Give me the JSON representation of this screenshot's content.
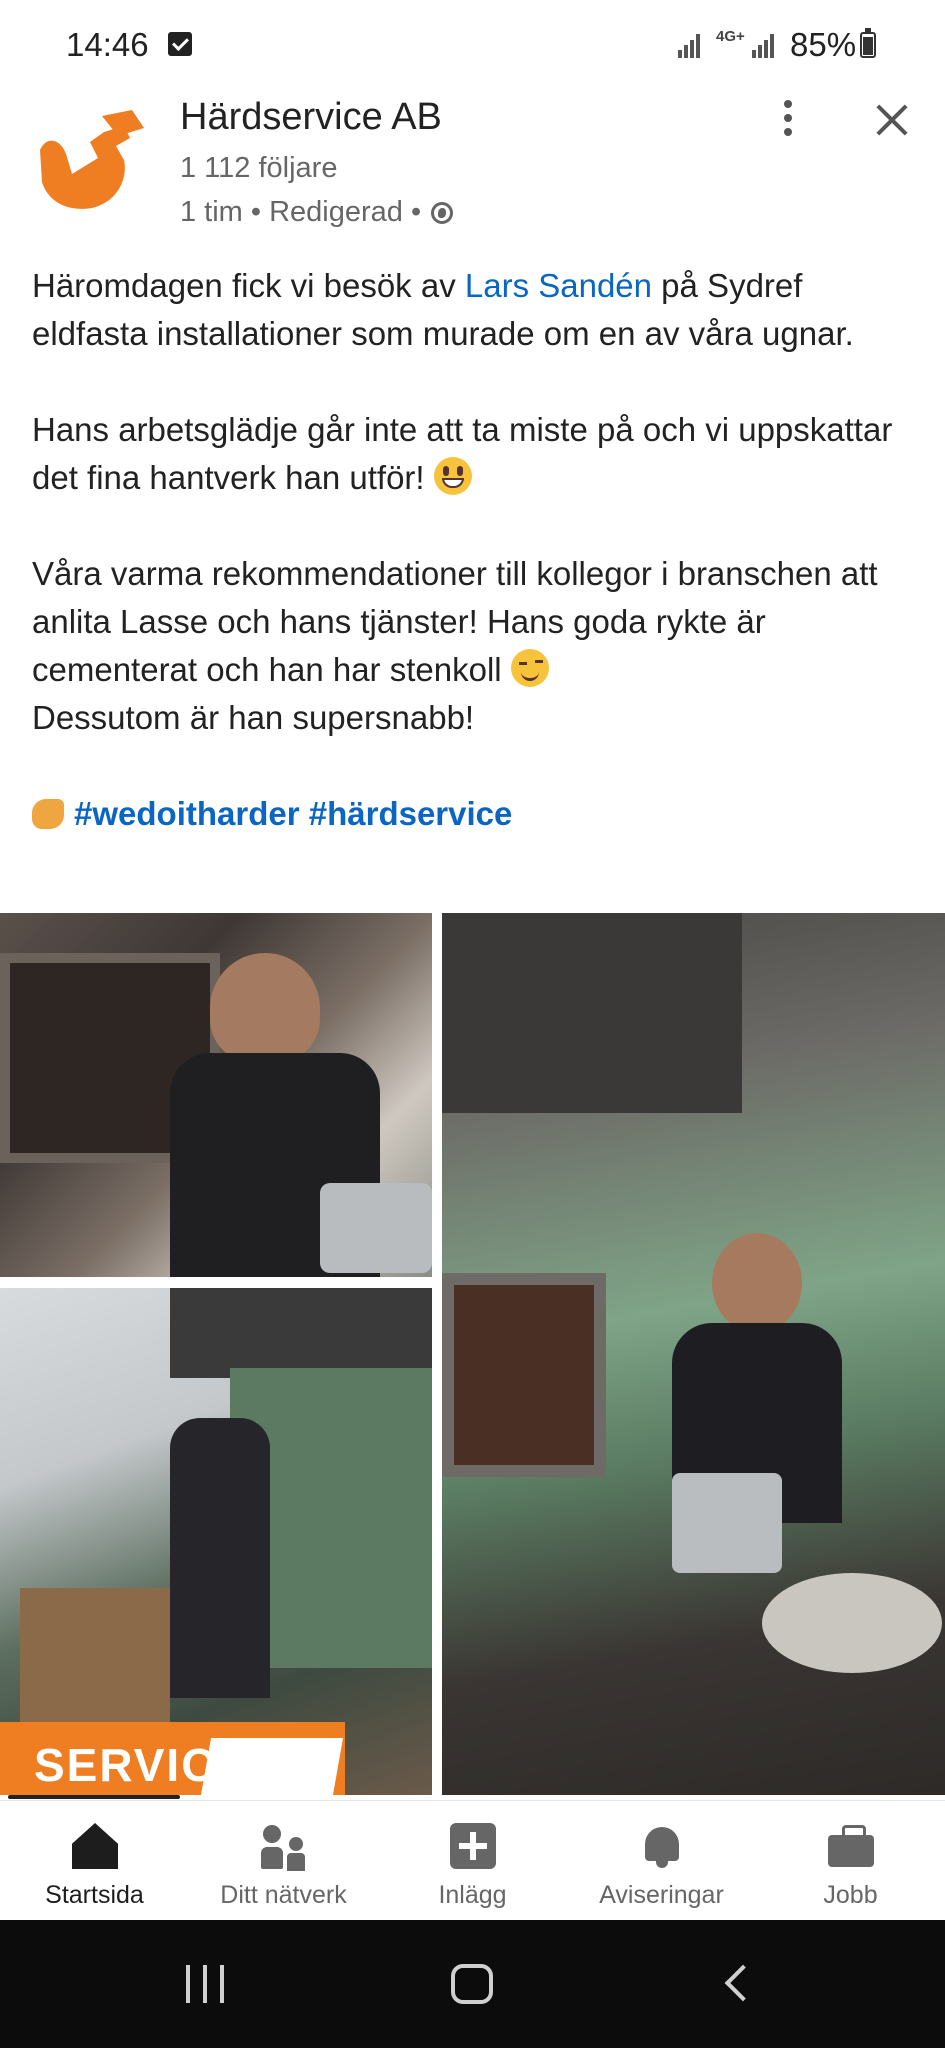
{
  "status_bar": {
    "time": "14:46",
    "network": "4G+",
    "battery": "85%"
  },
  "post": {
    "company_name": "Härdservice AB",
    "followers": "1 112 följare",
    "meta": "1 tim • Redigerad •",
    "paragraph1_a": "Häromdagen fick vi besök av ",
    "mention": "Lars Sandén",
    "paragraph1_b": " på Sydref eldfasta installationer som murade om en av våra ugnar.",
    "paragraph2": "Hans arbetsglädje går inte att ta miste på och vi uppskattar det fina hantverk han utför!",
    "paragraph3": "Våra varma rekommendationer till kollegor i branschen att anlita Lasse och hans tjänster! Hans goda rykte är cementerat och han har stenkoll",
    "paragraph4": "Dessutom är han supersnabb!",
    "hashtag1": "#wedoitharder",
    "hashtag2": "#härdservice",
    "image_banner_text": "SERVICE"
  },
  "bottom_nav": {
    "items": [
      {
        "label": "Startsida",
        "icon": "home-icon"
      },
      {
        "label": "Ditt nätverk",
        "icon": "network-icon"
      },
      {
        "label": "Inlägg",
        "icon": "add-post-icon"
      },
      {
        "label": "Aviseringar",
        "icon": "bell-icon"
      },
      {
        "label": "Jobb",
        "icon": "briefcase-icon"
      }
    ]
  },
  "colors": {
    "link": "#0a66c2",
    "logo_orange": "#ef7d22",
    "active_nav": "#1d1d1d"
  }
}
